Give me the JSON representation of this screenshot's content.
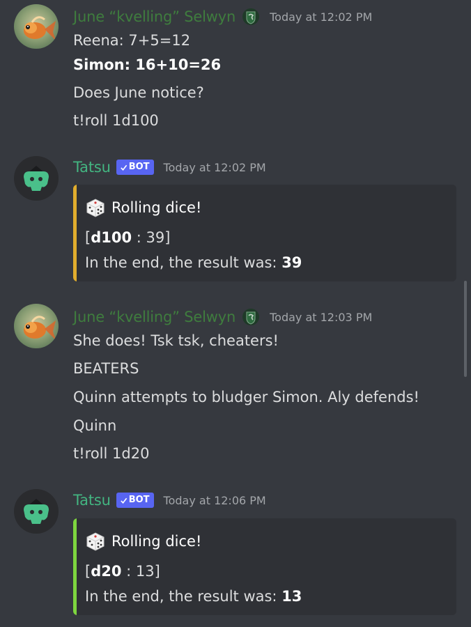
{
  "colors": {
    "background": "#36393f",
    "june_name": "#3f7d3e",
    "tatsu_name": "#43b581",
    "bot_tag": "#5865f2",
    "embed_bg": "#2f3136",
    "embed_bar_gold": "#e1ad2d",
    "embed_bar_green": "#7ed63f"
  },
  "icons": {
    "server_badge": "slytherin-badge-icon",
    "dice": "dice-icon",
    "bot_check": "check-icon"
  },
  "messages": [
    {
      "author": "June “kvelling” Selwyn",
      "timestamp": "Today at 12:02 PM",
      "lines": [
        "Reena: 7+5=12",
        "Simon: 16+10=26",
        "Does June notice?",
        "t!roll 1d100"
      ]
    },
    {
      "author": "Tatsu",
      "bot_tag": "BOT",
      "timestamp": "Today at 12:02 PM",
      "embed": {
        "title": "Rolling dice!",
        "die": "d100",
        "die_result": " : 39]",
        "result_prefix": "In the end, the result was: ",
        "result_value": "39"
      }
    },
    {
      "author": "June “kvelling” Selwyn",
      "timestamp": "Today at 12:03 PM",
      "lines": [
        "She does! Tsk tsk, cheaters!",
        "BEATERS",
        "Quinn attempts to bludger Simon. Aly defends!",
        "Quinn",
        "t!roll 1d20"
      ]
    },
    {
      "author": "Tatsu",
      "bot_tag": "BOT",
      "timestamp": "Today at 12:06 PM",
      "embed": {
        "title": "Rolling dice!",
        "die": "d20",
        "die_result": " : 13]",
        "result_prefix": "In the end, the result was: ",
        "result_value": "13"
      }
    }
  ]
}
